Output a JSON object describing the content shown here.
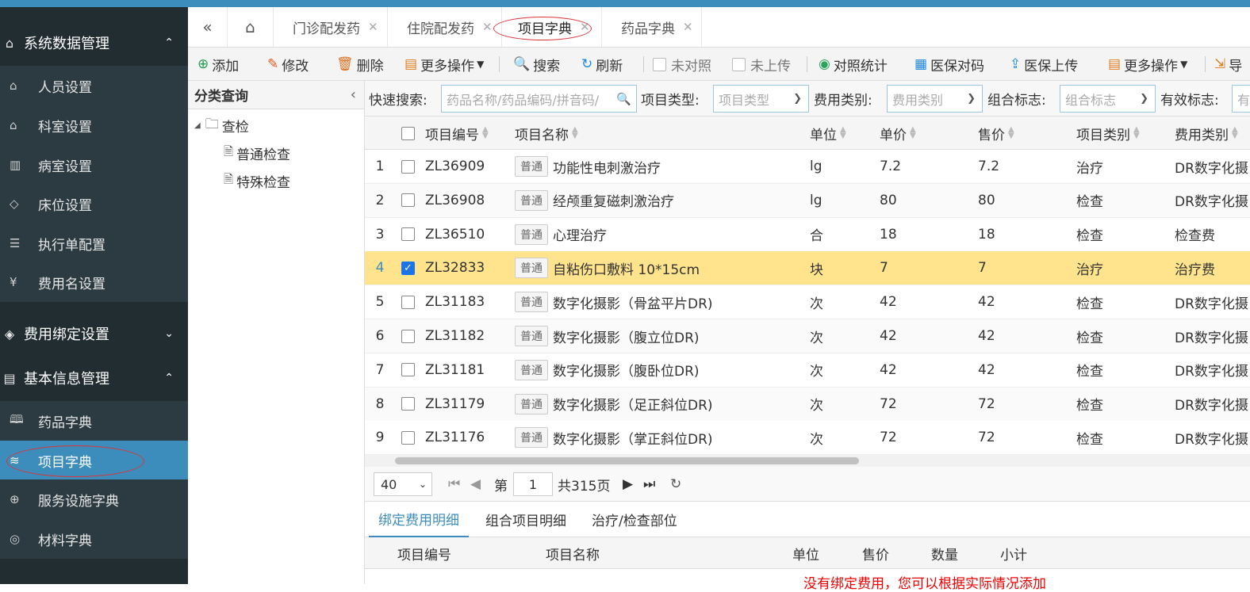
{
  "sidebar": {
    "groups": [
      {
        "label": "系统数据管理",
        "icon": "home-icon",
        "expanded": true
      },
      {
        "label": "费用绑定设置",
        "icon": "diamond-icon",
        "expanded": false
      },
      {
        "label": "基本信息管理",
        "icon": "document-icon",
        "expanded": true
      }
    ],
    "system_items": [
      {
        "label": "人员设置",
        "icon": "home-icon"
      },
      {
        "label": "科室设置",
        "icon": "home-icon"
      },
      {
        "label": "病室设置",
        "icon": "building-icon"
      },
      {
        "label": "床位设置",
        "icon": "tag-icon"
      },
      {
        "label": "执行单配置",
        "icon": "list-icon"
      },
      {
        "label": "费用名设置",
        "icon": "yen-icon"
      }
    ],
    "basic_items": [
      {
        "label": "药品字典",
        "icon": "book-icon"
      },
      {
        "label": "项目字典",
        "icon": "layers-icon",
        "active": true
      },
      {
        "label": "服务设施字典",
        "icon": "globe-icon"
      },
      {
        "label": "材料字典",
        "icon": "palette-icon"
      }
    ]
  },
  "tabs": [
    {
      "label": "门诊配发药",
      "active": false
    },
    {
      "label": "住院配发药",
      "active": false
    },
    {
      "label": "项目字典",
      "active": true
    },
    {
      "label": "药品字典",
      "active": false
    }
  ],
  "toolbar": {
    "add": "添加",
    "edit": "修改",
    "delete": "删除",
    "more1": "更多操作",
    "search": "搜索",
    "refresh": "刷新",
    "unmatched": "未对照",
    "unuploaded": "未上传",
    "compare_stats": "对照统计",
    "insurance_match": "医保对码",
    "insurance_upload": "医保上传",
    "more2": "更多操作",
    "export": "导"
  },
  "category": {
    "title": "分类查询",
    "root": "查检",
    "children": [
      "普通检查",
      "特殊检查"
    ]
  },
  "filters": {
    "quick_search_label": "快速搜索:",
    "quick_search_placeholder": "药品名称/药品编码/拼音码/",
    "item_type_label": "项目类型:",
    "item_type_placeholder": "项目类型",
    "fee_type_label": "费用类别:",
    "fee_type_placeholder": "费用类别",
    "combo_label": "组合标志:",
    "combo_placeholder": "组合标志",
    "valid_label": "有效标志:",
    "valid_placeholder": "有"
  },
  "grid": {
    "columns": [
      "项目编号",
      "项目名称",
      "单位",
      "单价",
      "售价",
      "项目类别",
      "费用类别"
    ],
    "badge": "普通",
    "rows": [
      {
        "n": "1",
        "code": "ZL36909",
        "name": "功能性电刺激治疗",
        "unit": "lg",
        "price": "7.2",
        "sale": "7.2",
        "category": "治疗",
        "fee": "DR数字化摄",
        "checked": false
      },
      {
        "n": "2",
        "code": "ZL36908",
        "name": "经颅重复磁刺激治疗",
        "unit": "lg",
        "price": "80",
        "sale": "80",
        "category": "检查",
        "fee": "DR数字化摄",
        "checked": false
      },
      {
        "n": "3",
        "code": "ZL36510",
        "name": "心理治疗",
        "unit": "合",
        "price": "18",
        "sale": "18",
        "category": "检查",
        "fee": "检查费",
        "checked": false
      },
      {
        "n": "4",
        "code": "ZL32833",
        "name": "自粘伤口敷料 10*15cm",
        "unit": "块",
        "price": "7",
        "sale": "7",
        "category": "治疗",
        "fee": "治疗费",
        "checked": true
      },
      {
        "n": "5",
        "code": "ZL31183",
        "name": "数字化摄影（骨盆平片DR)",
        "unit": "次",
        "price": "42",
        "sale": "42",
        "category": "检查",
        "fee": "DR数字化摄",
        "checked": false
      },
      {
        "n": "6",
        "code": "ZL31182",
        "name": "数字化摄影（腹立位DR)",
        "unit": "次",
        "price": "42",
        "sale": "42",
        "category": "检查",
        "fee": "DR数字化摄",
        "checked": false
      },
      {
        "n": "7",
        "code": "ZL31181",
        "name": "数字化摄影（腹卧位DR)",
        "unit": "次",
        "price": "42",
        "sale": "42",
        "category": "检查",
        "fee": "DR数字化摄",
        "checked": false
      },
      {
        "n": "8",
        "code": "ZL31179",
        "name": "数字化摄影（足正斜位DR)",
        "unit": "次",
        "price": "72",
        "sale": "72",
        "category": "检查",
        "fee": "DR数字化摄",
        "checked": false
      },
      {
        "n": "9",
        "code": "ZL31176",
        "name": "数字化摄影（掌正斜位DR)",
        "unit": "次",
        "price": "72",
        "sale": "72",
        "category": "检查",
        "fee": "DR数字化摄",
        "checked": false
      }
    ]
  },
  "pager": {
    "page_size": "40",
    "page_label": "第",
    "page": "1",
    "total": "共315页"
  },
  "bottom": {
    "tabs": [
      "绑定费用明细",
      "组合项目明细",
      "治疗/检查部位"
    ],
    "columns": [
      "项目编号",
      "项目名称",
      "单位",
      "售价",
      "数量",
      "小计"
    ],
    "message": "没有绑定费用，您可以根据实际情况添加"
  }
}
